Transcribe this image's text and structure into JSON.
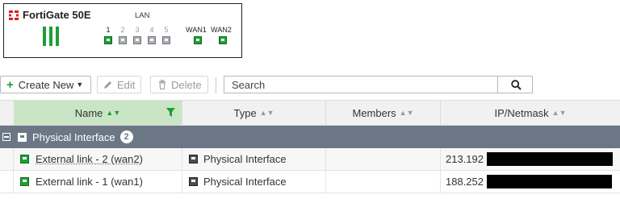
{
  "device": {
    "name": "FortiGate 50E",
    "lan_label": "LAN",
    "ports": [
      {
        "label": "1",
        "status": "up"
      },
      {
        "label": "2",
        "status": "down"
      },
      {
        "label": "3",
        "status": "down"
      },
      {
        "label": "4",
        "status": "down"
      },
      {
        "label": "5",
        "status": "down"
      },
      {
        "label": "WAN1",
        "status": "up"
      },
      {
        "label": "WAN2",
        "status": "up"
      }
    ]
  },
  "toolbar": {
    "create_label": "Create New",
    "edit_label": "Edit",
    "delete_label": "Delete",
    "search_placeholder": "Search"
  },
  "table": {
    "columns": [
      "Name",
      "Type",
      "Members",
      "IP/Netmask"
    ],
    "group": {
      "label": "Physical Interface",
      "count": "2"
    },
    "rows": [
      {
        "name": "External link - 2 (wan2)",
        "type": "Physical Interface",
        "members": "",
        "ip_prefix": "213.192"
      },
      {
        "name": "External link - 1 (wan1)",
        "type": "Physical Interface",
        "members": "",
        "ip_prefix": "188.252"
      }
    ]
  },
  "colors": {
    "accent_green": "#1e9e32",
    "group_row": "#6c7785",
    "sorted_header": "#c9e5c6"
  }
}
